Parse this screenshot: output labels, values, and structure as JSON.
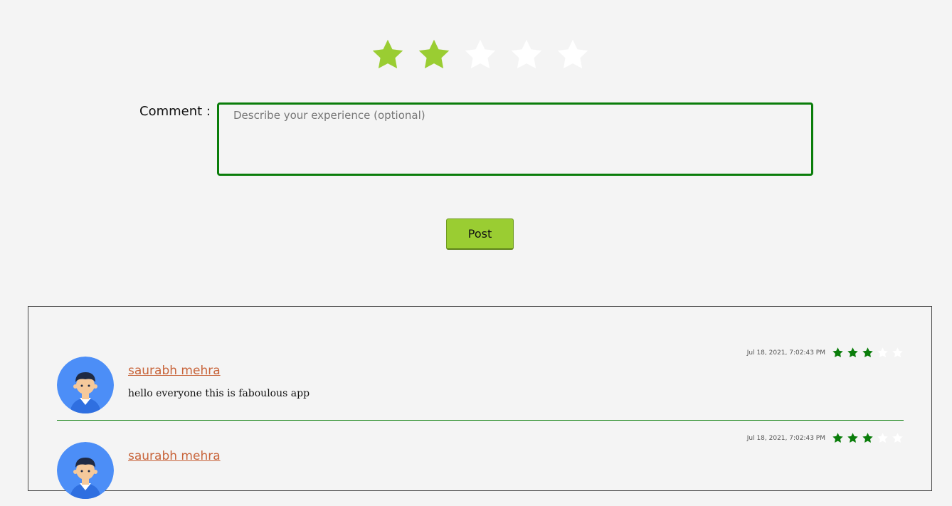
{
  "rating": {
    "max": 5,
    "value": 2,
    "filled_color": "#9acd32",
    "empty_color": "#ffffff",
    "icon": "star-icon"
  },
  "comment": {
    "label": "Comment :",
    "placeholder": "Describe your experience (optional)",
    "value": ""
  },
  "post_button": {
    "label": "Post",
    "color": "#9acd32"
  },
  "reviews": [
    {
      "name": "saurabh mehra",
      "text": "hello everyone this is faboulous app",
      "date": "Jul 18, 2021, 7:02:43 PM",
      "rating": 3,
      "rating_max": 5,
      "avatar": "user-avatar-icon"
    },
    {
      "name": "saurabh mehra",
      "text": "",
      "date": "Jul 18, 2021, 7:02:43 PM",
      "rating": 3,
      "rating_max": 5,
      "avatar": "user-avatar-icon"
    }
  ],
  "colors": {
    "accent_green": "#0a7d0a",
    "name_link": "#c8643a",
    "background": "#f4f4f4"
  }
}
